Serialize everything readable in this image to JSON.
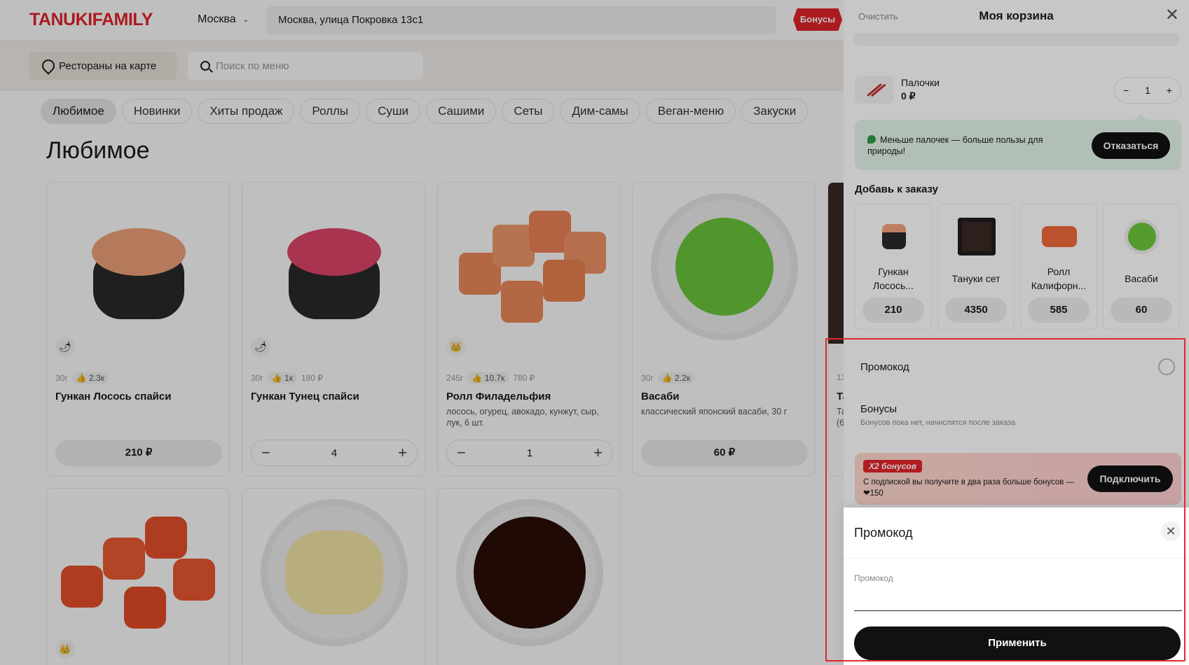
{
  "header": {
    "logo": "TANUKIFAMILY",
    "city": "Москва",
    "address": "Москва, улица Покровка 13с1",
    "bonus_badge": "Бонусы"
  },
  "subbar": {
    "map_button": "Рестораны на карте",
    "search_placeholder": "Поиск по меню"
  },
  "categories": [
    "Любимое",
    "Новинки",
    "Хиты продаж",
    "Роллы",
    "Суши",
    "Сашими",
    "Сеты",
    "Дим-самы",
    "Веган-меню",
    "Закуски"
  ],
  "section_title": "Любимое",
  "products": [
    {
      "weight": "30г",
      "likes": "2.3к",
      "old_price": "",
      "name": "Гункан Лосось спайси",
      "desc": "",
      "price": "210 ₽",
      "qty": ""
    },
    {
      "weight": "30г",
      "likes": "1к",
      "old_price": "180 ₽",
      "name": "Гункан Тунец спайси",
      "desc": "",
      "price": "",
      "qty": "4"
    },
    {
      "weight": "245г",
      "likes": "10.7к",
      "old_price": "780 ₽",
      "name": "Ролл Филадельфия",
      "desc": "лосось, огурец, авокадо, кунжут, сыр, лук, 6 шт.",
      "price": "",
      "qty": "1"
    },
    {
      "weight": "30г",
      "likes": "2.2к",
      "old_price": "",
      "name": "Васаби",
      "desc": "классический японский васаби, 30 г",
      "price": "60 ₽",
      "qty": ""
    }
  ],
  "partial_card": {
    "weight": "13",
    "name": "Та",
    "desc": "Та\n(6"
  },
  "cart": {
    "clear": "Очистить",
    "title": "Моя корзина",
    "sticks_name": "Палочки",
    "sticks_price": "0 ₽",
    "sticks_qty": "1",
    "eco_text": "Меньше палочек — больше пользы для природы!",
    "eco_button": "Отказаться",
    "addons_title": "Добавь к заказу",
    "addons": [
      {
        "name": "Гункан Лосось...",
        "price": "210"
      },
      {
        "name": "Тануки сет",
        "price": "4350"
      },
      {
        "name": "Ролл Калифорн...",
        "price": "585"
      },
      {
        "name": "Васаби",
        "price": "60"
      }
    ],
    "promo_label": "Промокод",
    "bonus_label": "Бонусы",
    "bonus_sub": "Бонусов пока нет, начислятся после заказа",
    "x2_tag": "X2 бонусов",
    "x2_text": "С подпиской вы получите в два раза больше бонусов — ❤150",
    "x2_button": "Подключить"
  },
  "promo_modal": {
    "title": "Промокод",
    "field_label": "Промокод",
    "input_value": "",
    "apply": "Применить"
  },
  "colors": {
    "brand": "#e3252b",
    "dark_button": "#111111",
    "eco_bg": "#e4f5ea"
  }
}
